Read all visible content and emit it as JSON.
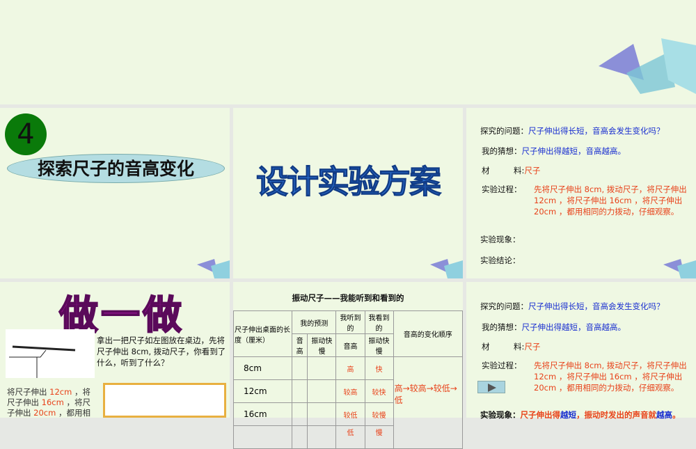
{
  "slide1": {
    "number": "4",
    "title": "探索尺子的音高变化"
  },
  "slide2": {
    "title": "设计实验方案"
  },
  "slide3": {
    "question_label": "探究的问题：",
    "question": "尺子伸出得长短，音高会发生变化吗？",
    "guess_label": "我的猜想：",
    "guess": "尺子伸出得越短，音高越高。",
    "material_label": "材　　　料:",
    "material": "尺子",
    "process_label": "实验过程：",
    "process": "先将尺子伸出 8cm, 拨动尺子，将尺子伸出 12cm ，将尺子伸出 16cm ，将尺子伸出 20cm ，都用相同的力拨动，仔细观察。",
    "phenomenon_label": "实验现象：",
    "conclusion_label": "实验结论："
  },
  "slide4": {
    "title": "做一做",
    "text1": "拿出一把尺子如左图放在桌边，先将尺子伸出 8cm, 拨动尺子，你看到了什么，听到了什么？",
    "text2a": "将尺子伸出 ",
    "v12": "12cm",
    "text2b": " ，将尺子伸出 ",
    "v16": "16cm",
    "text2c": " ，将尺子伸出 ",
    "v20": "20cm",
    "text2d": " ，都用相"
  },
  "slide5": {
    "title": "振动尺子——我能听到和看到的",
    "headers": {
      "length": "尺子伸出桌面的长度（厘米）",
      "predict": "我的预测",
      "heard": "我听到的",
      "seen": "我看到的",
      "order": "音高的变化顺序",
      "pitch": "音高",
      "speed": "振动快慢"
    },
    "rows": [
      {
        "len": "8cm",
        "pitch": "高",
        "speed": "快"
      },
      {
        "len": "12cm",
        "pitch": "较高",
        "speed": "较快"
      },
      {
        "len": "16cm",
        "pitch": "较低",
        "speed": "较慢"
      },
      {
        "len": "",
        "pitch": "低",
        "speed": "慢"
      }
    ],
    "order": "高→较高→较低→低"
  },
  "slide6": {
    "phenomenon_a": "尺子伸出得",
    "short": "越短",
    "phenomenon_b": "，振动时发出的声音就",
    "high": "越高",
    "end": "。"
  }
}
